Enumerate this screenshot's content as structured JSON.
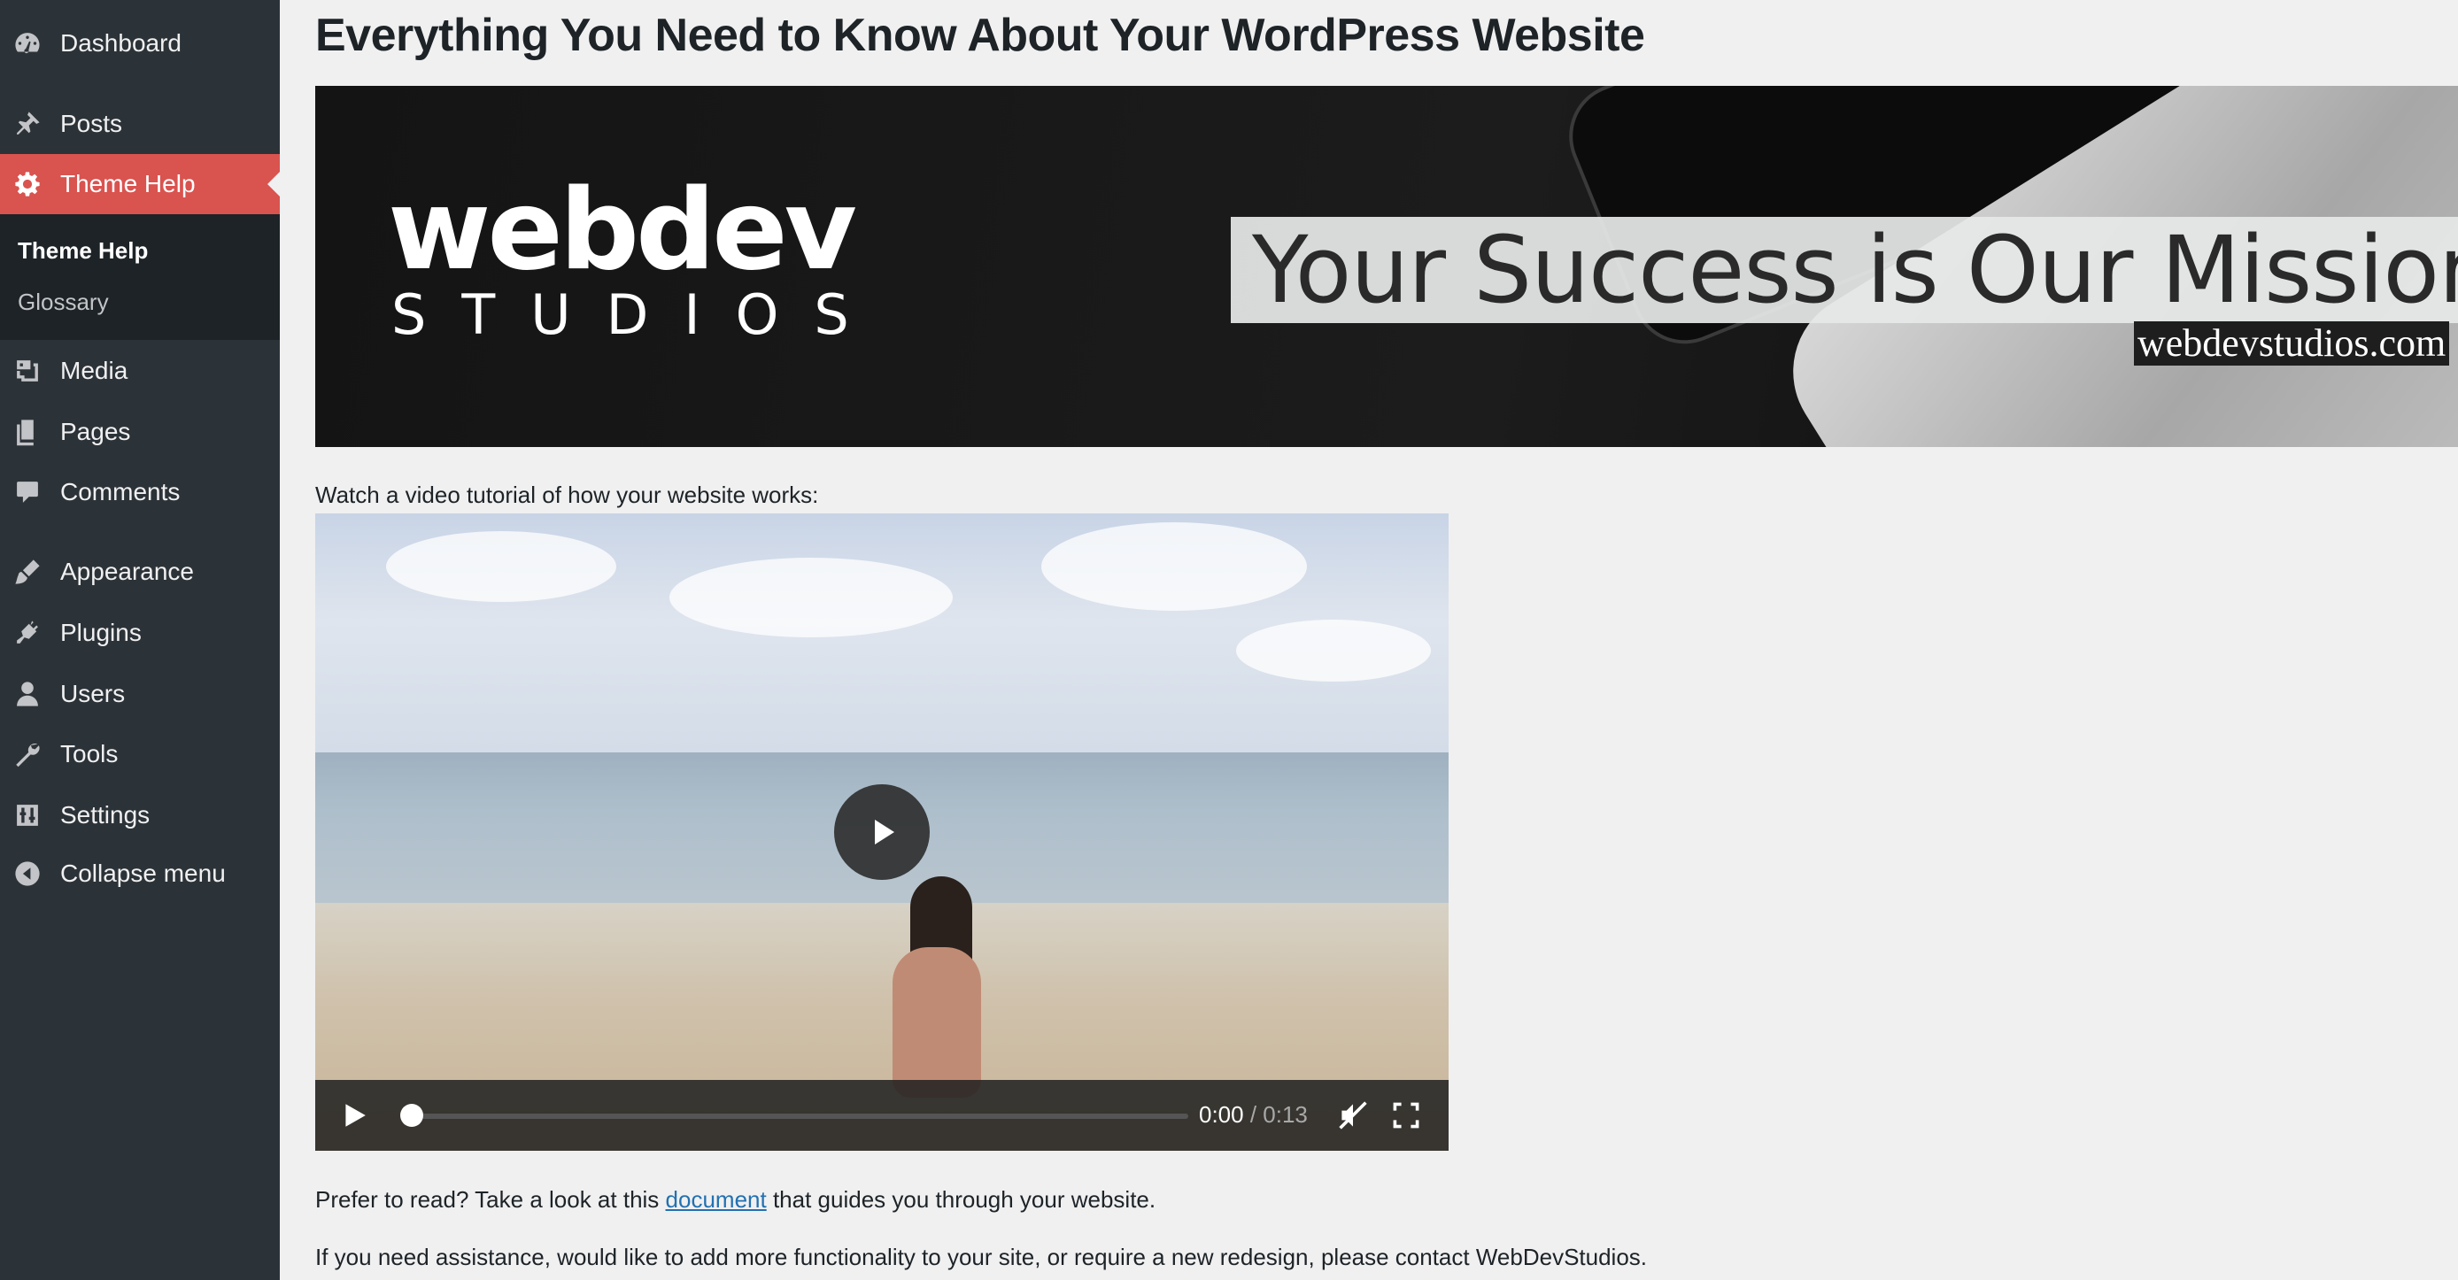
{
  "sidebar": {
    "items": [
      {
        "label": "Dashboard",
        "icon": "dashboard-icon"
      },
      {
        "label": "Posts",
        "icon": "pin-icon"
      },
      {
        "label": "Theme Help",
        "icon": "gear-icon"
      },
      {
        "label": "Media",
        "icon": "media-icon"
      },
      {
        "label": "Pages",
        "icon": "pages-icon"
      },
      {
        "label": "Comments",
        "icon": "comment-icon"
      },
      {
        "label": "Appearance",
        "icon": "brush-icon"
      },
      {
        "label": "Plugins",
        "icon": "plug-icon"
      },
      {
        "label": "Users",
        "icon": "user-icon"
      },
      {
        "label": "Tools",
        "icon": "wrench-icon"
      },
      {
        "label": "Settings",
        "icon": "sliders-icon"
      },
      {
        "label": "Collapse menu",
        "icon": "collapse-icon"
      }
    ],
    "submenu": [
      {
        "label": "Theme Help"
      },
      {
        "label": "Glossary"
      }
    ],
    "current_color": "#d9534f"
  },
  "main": {
    "title": "Everything You Need to Know About Your WordPress Website",
    "banner": {
      "logo_main": "webdev",
      "logo_sub": "STUDIOS",
      "tagline": "Your Success is Our Mission.",
      "url": "webdevstudios.com"
    },
    "video_intro": "Watch a video tutorial of how your website works:",
    "video": {
      "current_time": "0:00",
      "separator": " / ",
      "duration": "0:13",
      "progress": 0
    },
    "read_prefix": "Prefer to read? Take a look at this ",
    "read_link": "document",
    "read_suffix": " that guides you through your website.",
    "assist_text": "If you need assistance, would like to add more functionality to your site, or require a new redesign, please contact WebDevStudios.",
    "link_color": "#2271b1"
  }
}
